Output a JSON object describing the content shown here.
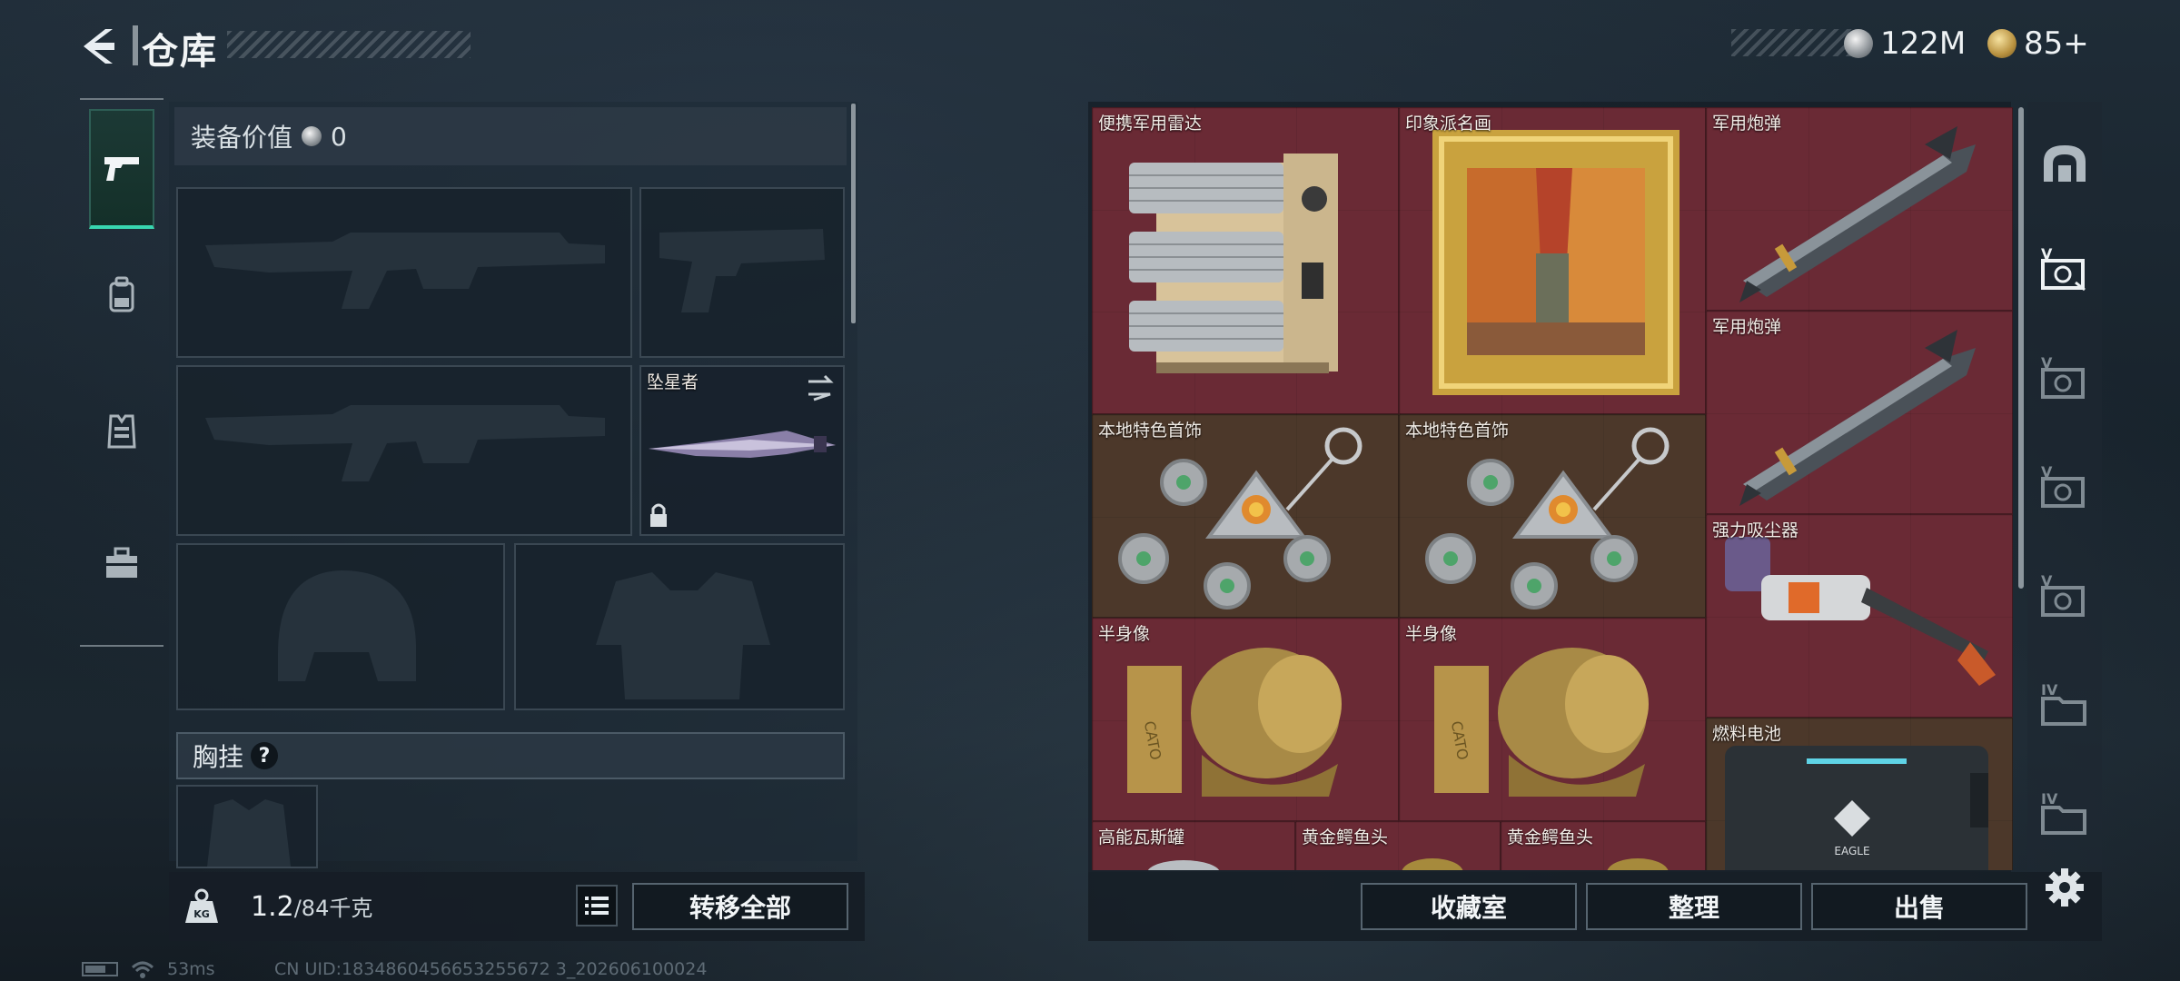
{
  "header": {
    "title": "仓库",
    "currencies": [
      {
        "icon": "silver-coin-icon",
        "value": "122M"
      },
      {
        "icon": "gold-coin-icon",
        "value": "85+"
      }
    ]
  },
  "left_rail": {
    "items": [
      {
        "icon": "pistol-icon",
        "active": true
      },
      {
        "icon": "backpack-icon",
        "active": false
      },
      {
        "icon": "vest-icon",
        "active": false
      },
      {
        "icon": "toolbox-icon",
        "active": false
      }
    ]
  },
  "loadout": {
    "value_label": "装备价值",
    "value": "0",
    "melee_slot_label": "坠星者",
    "chest_rig_label": "胸挂",
    "chest_help": "?"
  },
  "bottom_left": {
    "weight_current": "1.2",
    "weight_max": "/84千克",
    "weight_icon_text": "KG",
    "transfer_all": "转移全部"
  },
  "storage": {
    "items": [
      {
        "name": "便携军用雷达",
        "color": "red"
      },
      {
        "name": "印象派名画",
        "color": "red"
      },
      {
        "name": "军用炮弹",
        "color": "red"
      },
      {
        "name": "军用炮弹",
        "color": "red"
      },
      {
        "name": "本地特色首饰",
        "color": "brown"
      },
      {
        "name": "本地特色首饰",
        "color": "brown"
      },
      {
        "name": "强力吸尘器",
        "color": "red"
      },
      {
        "name": "半身像",
        "color": "red"
      },
      {
        "name": "半身像",
        "color": "red"
      },
      {
        "name": "燃料电池",
        "color": "brown"
      },
      {
        "name": "高能瓦斯罐",
        "color": "red"
      },
      {
        "name": "黄金鳄鱼头",
        "color": "red"
      },
      {
        "name": "黄金鳄鱼头",
        "color": "red"
      }
    ],
    "bust_inscription": "CATO",
    "battery_brand": "EAGLE",
    "buttons": {
      "vault": "收藏室",
      "sort": "整理",
      "sell": "出售"
    }
  },
  "right_rail": {
    "items": [
      {
        "icon": "vault-arch-icon",
        "label": ""
      },
      {
        "icon": "storage-box-icon",
        "label": "V"
      },
      {
        "icon": "storage-box-icon",
        "label": "V"
      },
      {
        "icon": "storage-box-icon",
        "label": "V"
      },
      {
        "icon": "storage-box-icon",
        "label": "V"
      },
      {
        "icon": "storage-folder-icon",
        "label": "IV"
      },
      {
        "icon": "storage-folder-icon",
        "label": "IV"
      }
    ]
  },
  "status_bar": {
    "ping": "53ms",
    "uid": "CN UID:1834860456653255672 3_202606100024"
  },
  "colors": {
    "accent": "#38d6b0",
    "cell_red": "#6a2a35",
    "cell_brown": "#4c382a"
  }
}
